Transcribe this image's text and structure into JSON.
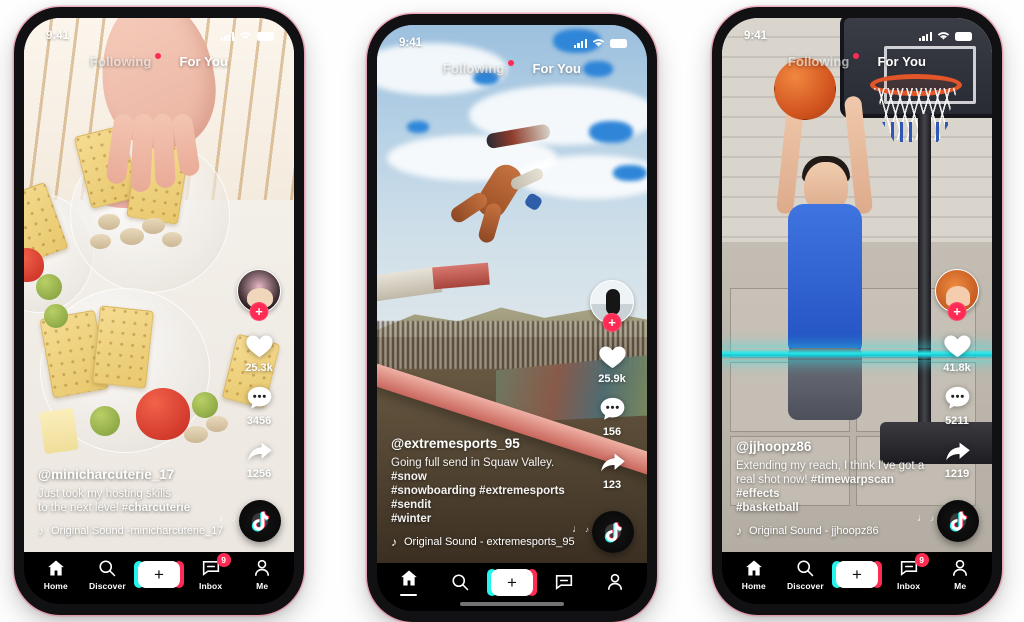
{
  "app": {
    "name": "TikTok"
  },
  "theme": {
    "accent_pink": "#fe2c55",
    "accent_cyan": "#25f4ee",
    "bezel": "#111114"
  },
  "phones": [
    {
      "id": "phone-1",
      "status": {
        "time": "9:41"
      },
      "topnav": {
        "following": "Following",
        "for_you": "For You"
      },
      "post": {
        "handle": "@minicharcuterie_17",
        "caption_line1": "Just took my hosting skills",
        "caption_line2_text": "to the next level ",
        "caption_line2_tag": "#charcuterie",
        "sound": "Original Sound -minicharcuterie_17",
        "likes": "25.3k",
        "comments": "3456",
        "shares": "1256"
      },
      "tabbar": {
        "show_labels": true,
        "home": "Home",
        "discover": "Discover",
        "inbox": "Inbox",
        "me": "Me",
        "inbox_badge": "9"
      }
    },
    {
      "id": "phone-2",
      "status": {
        "time": "9:41"
      },
      "topnav": {
        "following": "Following",
        "for_you": "For You"
      },
      "post": {
        "handle": "@extremesports_95",
        "caption_line1": "Going full send in Squaw Valley. ",
        "caption_line1_tag": "#snow",
        "caption_line2_tag": "#snowboarding #extremesports #sendit",
        "caption_line3_tag": "#winter",
        "sound": "Original Sound - extremesports_95",
        "likes": "25.9k",
        "comments": "156",
        "shares": "123"
      },
      "tabbar": {
        "show_labels": false,
        "home": "Home",
        "discover": "Discover",
        "inbox": "Inbox",
        "me": "Me",
        "inbox_badge": ""
      }
    },
    {
      "id": "phone-3",
      "status": {
        "time": "9:41"
      },
      "topnav": {
        "following": "Following",
        "for_you": "For You"
      },
      "post": {
        "handle": "@jjhoopz86",
        "caption_line1": "Extending my reach, I think I've got a",
        "caption_line2_text": "real shot now! ",
        "caption_line2_tag": "#timewarpscan #effects",
        "caption_line3_tag": "#basketball",
        "sound": "Original Sound - jjhoopz86",
        "likes": "41.8k",
        "comments": "5211",
        "shares": "1219"
      },
      "tabbar": {
        "show_labels": true,
        "home": "Home",
        "discover": "Discover",
        "inbox": "Inbox",
        "me": "Me",
        "inbox_badge": "9"
      }
    }
  ]
}
